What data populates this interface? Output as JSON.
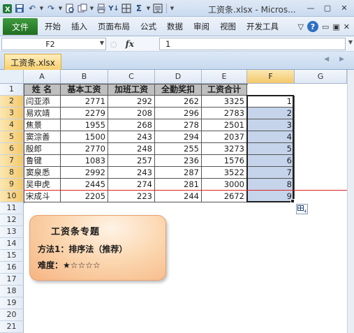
{
  "window": {
    "title": "工资条.xlsx - Micros...",
    "min_glyph": "—",
    "max_glyph": "▢",
    "close_glyph": "✕"
  },
  "qat": {
    "icons": [
      "excel-logo-icon",
      "save-icon",
      "undo-icon",
      "redo-icon",
      "print-preview-icon",
      "copy-format-icon",
      "quick-print-icon",
      "sort-icon",
      "borders-icon",
      "sum-icon",
      "align-icon",
      "customize-qat-icon"
    ]
  },
  "ribbon": {
    "file_tab": "文件",
    "tabs": [
      "开始",
      "插入",
      "页面布局",
      "公式",
      "数据",
      "审阅",
      "视图",
      "开发工具"
    ],
    "help": "?"
  },
  "formula_bar": {
    "name_box": "F2",
    "fx": "fx",
    "formula": "1"
  },
  "workbook_tab": "工资条.xlsx",
  "columns": [
    "A",
    "B",
    "C",
    "D",
    "E",
    "F",
    "G"
  ],
  "rows": [
    "1",
    "2",
    "3",
    "4",
    "5",
    "6",
    "7",
    "8",
    "9",
    "10",
    "11",
    "12",
    "13",
    "14",
    "15",
    "16",
    "17",
    "18",
    "19",
    "20",
    "21"
  ],
  "table": {
    "headers": [
      "姓 名",
      "基本工资",
      "加班工资",
      "全勤奖扣",
      "工资合计"
    ],
    "records": [
      [
        "闫亚添",
        "2771",
        "292",
        "262",
        "3325",
        "1"
      ],
      [
        "易欢靖",
        "2279",
        "208",
        "296",
        "2783",
        "2"
      ],
      [
        "焦景",
        "1955",
        "268",
        "278",
        "2501",
        "3"
      ],
      [
        "窦淙善",
        "1500",
        "243",
        "294",
        "2037",
        "4"
      ],
      [
        "殷郎",
        "2770",
        "248",
        "255",
        "3273",
        "5"
      ],
      [
        "鲁键",
        "1083",
        "257",
        "236",
        "1576",
        "6"
      ],
      [
        "窦泉悉",
        "2992",
        "243",
        "287",
        "3522",
        "7"
      ],
      [
        "吴申虎",
        "2445",
        "274",
        "281",
        "3000",
        "8"
      ],
      [
        "宋成斗",
        "2205",
        "223",
        "244",
        "2672",
        "9"
      ]
    ]
  },
  "callout": {
    "title": "工资条专题",
    "line1": "方法1：排序法（推荐）",
    "line2": "难度：★☆☆☆☆"
  },
  "colors": {
    "file_tab": "#2b7a2b",
    "selection": "#c5d4ea",
    "header_fill": "#bfbfbf",
    "callout": "#f6b482",
    "guide_line": "#dd2222"
  }
}
